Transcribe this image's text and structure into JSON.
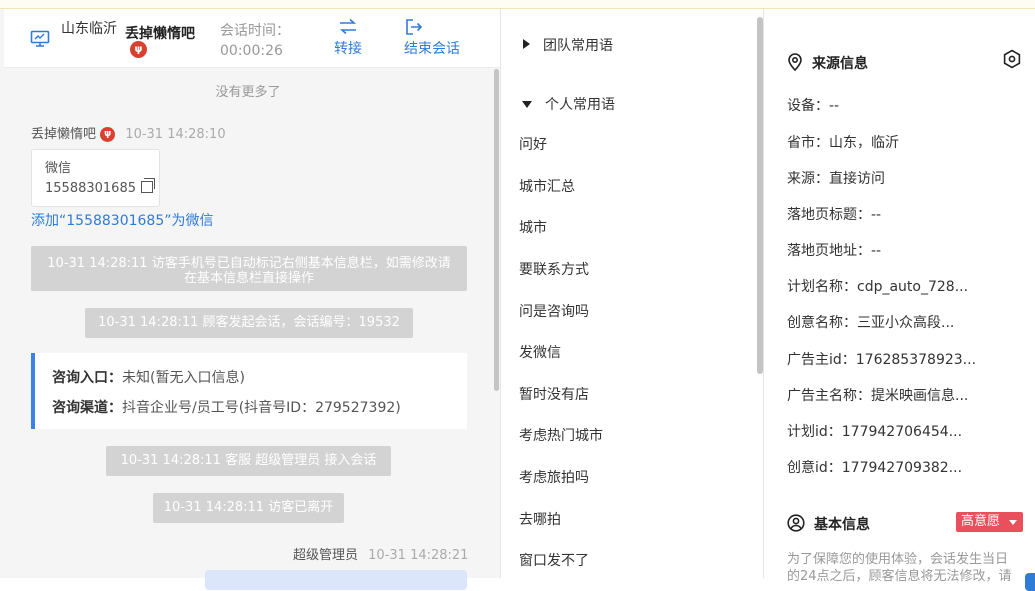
{
  "header": {
    "region": "山东临沂",
    "visitor_name": "丢掉懒惰吧",
    "devil_emoji": "👹",
    "session_time_label": "会话时间：",
    "session_time_value": "00:00:26",
    "transfer_label": "转接",
    "end_label": "结束会话"
  },
  "chat": {
    "no_more": "没有更多了",
    "visitor_msg": {
      "sender": "丢掉懒惰吧",
      "time": "10-31 14:28:10",
      "card_title": "微信",
      "card_value": "15588301685",
      "add_link": "添加“15588301685”为微信"
    },
    "system_messages": [
      "10-31 14:28:11 访客手机号已自动标记右侧基本信息栏，如需修改请在基本信息栏直接操作",
      "10-31 14:28:11 顾客发起会话，会话编号：19532",
      "10-31 14:28:11 客服 超级管理员 接入会话",
      "10-31 14:28:11 访客已离开"
    ],
    "entry": {
      "entry_label": "咨询入口：",
      "entry_value": "未知(暂无入口信息)",
      "channel_label": "咨询渠道：",
      "channel_value": "抖音企业号/员工号(抖音号ID：279527392)"
    },
    "agent_msg": {
      "sender": "超级管理员",
      "time": "10-31 14:28:21"
    }
  },
  "phrases": {
    "team_group": "团队常用语",
    "personal_group": "个人常用语",
    "items": [
      "问好",
      "城市汇总",
      "城市",
      "要联系方式",
      "问是咨询吗",
      "发微信",
      "暂时没有店",
      "考虑热门城市",
      "考虑旅拍吗",
      "去哪拍",
      "窗口发不了"
    ]
  },
  "info": {
    "source_title": "来源信息",
    "fields": [
      "设备：--",
      "省市：山东，临沂",
      "来源：直接访问",
      "落地页标题：--",
      "落地页地址：--",
      "计划名称：cdp_auto_728...",
      "创意名称：三亚小众高段...",
      "广告主id：176285378923...",
      "广告主名称：提米映画信息...",
      "计划id：177942706454...",
      "创意id：177942709382..."
    ],
    "basic_title": "基本信息",
    "intent_badge": "高意愿",
    "notice": "为了保障您的使用体验，会话发生当日的24点之后，顾客信息将无法修改，请"
  },
  "colors": {
    "accent": "#2f7bd8",
    "system_bubble": "#d3d3d3",
    "badge": "#e8505b",
    "entry_border": "#3b82e8"
  }
}
